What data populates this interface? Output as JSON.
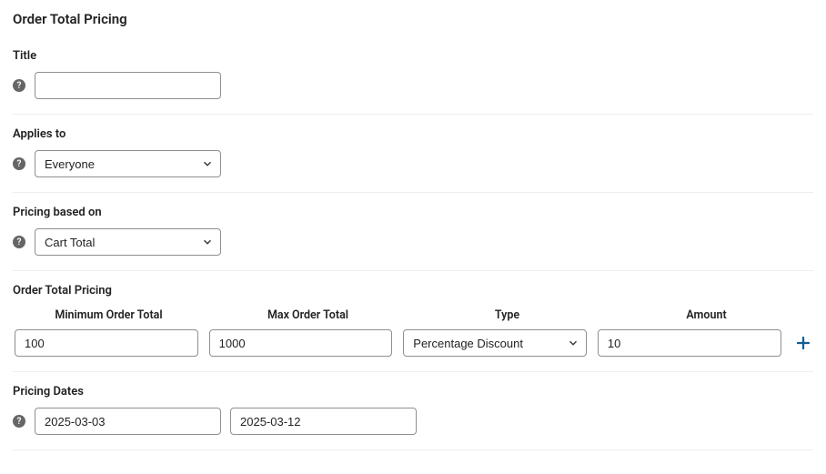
{
  "page_title": "Order Total Pricing",
  "title_section": {
    "label": "Title",
    "value": ""
  },
  "applies_to": {
    "label": "Applies to",
    "value": "Everyone"
  },
  "pricing_based_on": {
    "label": "Pricing based on",
    "value": "Cart Total"
  },
  "pricing_table": {
    "label": "Order Total Pricing",
    "headers": {
      "min": "Minimum Order Total",
      "max": "Max Order Total",
      "type": "Type",
      "amount": "Amount"
    },
    "row": {
      "min": "100",
      "max": "1000",
      "type": "Percentage Discount",
      "amount": "10"
    }
  },
  "pricing_dates": {
    "label": "Pricing Dates",
    "from": "2025-03-03",
    "to": "2025-03-12"
  }
}
